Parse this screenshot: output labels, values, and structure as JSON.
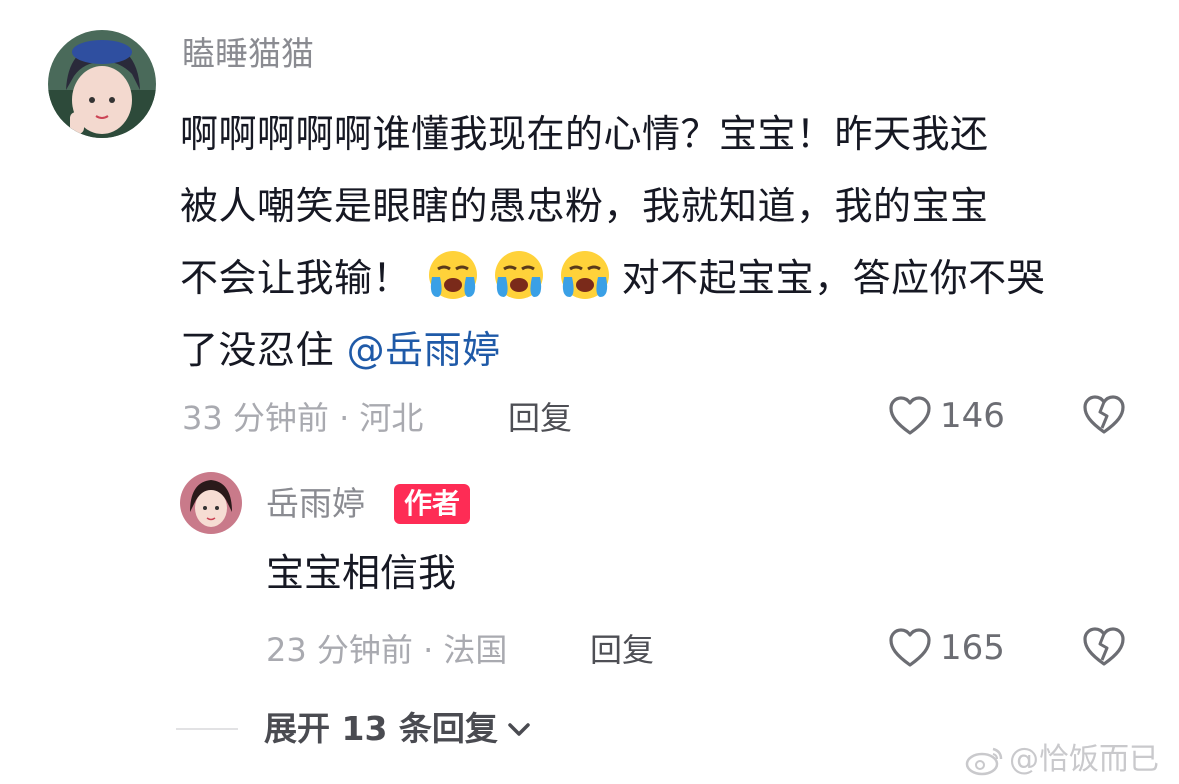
{
  "comment": {
    "username": "瞌睡猫猫",
    "text_line1": "啊啊啊啊啊谁懂我现在的心情？宝宝！昨天我还",
    "text_line2": "被人嘲笑是眼瞎的愚忠粉，我就知道，我的宝宝",
    "text_line3_before": "不会让我输！",
    "text_line3_after": "对不起宝宝，答应你不哭",
    "text_line4": "了没忍住",
    "mention": "@岳雨婷",
    "time_location": "33 分钟前 · 河北",
    "reply_label": "回复",
    "like_count": "146",
    "emoji_name": "loudly-crying-face-icon"
  },
  "reply": {
    "username": "岳雨婷",
    "badge": "作者",
    "text": "宝宝相信我",
    "time_location": "23 分钟前 · 法国",
    "reply_label": "回复",
    "like_count": "165"
  },
  "expand_label": "展开 13 条回复",
  "watermark": "@恰饭而已",
  "colors": {
    "mention": "#1f5aa8",
    "badge": "#fe2c55",
    "meta_gray": "#a9aab0",
    "username_gray": "#8a8b91"
  }
}
